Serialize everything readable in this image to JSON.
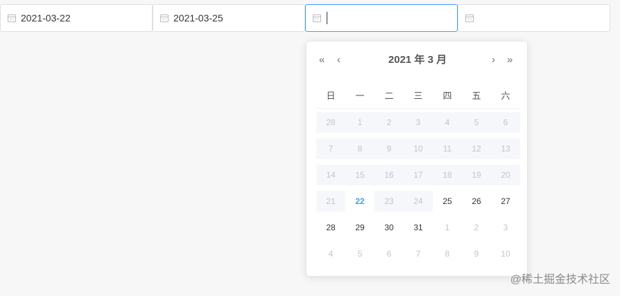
{
  "fields": [
    {
      "value": "2021-03-22",
      "icon": "calendar-icon"
    },
    {
      "value": "2021-03-25",
      "icon": "calendar-icon"
    },
    {
      "value": "",
      "icon": "calendar-icon"
    },
    {
      "value": "",
      "icon": "calendar-icon"
    }
  ],
  "calendar": {
    "prev_year": "«",
    "prev_month": "‹",
    "next_month": "›",
    "next_year": "»",
    "title": "2021 年  3 月",
    "weekdays": [
      "日",
      "一",
      "二",
      "三",
      "四",
      "五",
      "六"
    ],
    "weeks": [
      [
        {
          "d": "28",
          "s": "disabled"
        },
        {
          "d": "1",
          "s": "disabled"
        },
        {
          "d": "2",
          "s": "disabled"
        },
        {
          "d": "3",
          "s": "disabled"
        },
        {
          "d": "4",
          "s": "disabled"
        },
        {
          "d": "5",
          "s": "disabled"
        },
        {
          "d": "6",
          "s": "disabled"
        }
      ],
      [
        {
          "d": "7",
          "s": "disabled"
        },
        {
          "d": "8",
          "s": "disabled"
        },
        {
          "d": "9",
          "s": "disabled"
        },
        {
          "d": "10",
          "s": "disabled"
        },
        {
          "d": "11",
          "s": "disabled"
        },
        {
          "d": "12",
          "s": "disabled"
        },
        {
          "d": "13",
          "s": "disabled"
        }
      ],
      [
        {
          "d": "14",
          "s": "disabled"
        },
        {
          "d": "15",
          "s": "disabled"
        },
        {
          "d": "16",
          "s": "disabled"
        },
        {
          "d": "17",
          "s": "disabled"
        },
        {
          "d": "18",
          "s": "disabled"
        },
        {
          "d": "19",
          "s": "disabled"
        },
        {
          "d": "20",
          "s": "disabled"
        }
      ],
      [
        {
          "d": "21",
          "s": "disabled"
        },
        {
          "d": "22",
          "s": "today"
        },
        {
          "d": "23",
          "s": "disabled"
        },
        {
          "d": "24",
          "s": "disabled"
        },
        {
          "d": "25",
          "s": "available"
        },
        {
          "d": "26",
          "s": "available"
        },
        {
          "d": "27",
          "s": "available"
        }
      ],
      [
        {
          "d": "28",
          "s": "available"
        },
        {
          "d": "29",
          "s": "available"
        },
        {
          "d": "30",
          "s": "available"
        },
        {
          "d": "31",
          "s": "available"
        },
        {
          "d": "1",
          "s": "other"
        },
        {
          "d": "2",
          "s": "other"
        },
        {
          "d": "3",
          "s": "other"
        }
      ],
      [
        {
          "d": "4",
          "s": "other"
        },
        {
          "d": "5",
          "s": "other"
        },
        {
          "d": "6",
          "s": "other"
        },
        {
          "d": "7",
          "s": "other"
        },
        {
          "d": "8",
          "s": "other"
        },
        {
          "d": "9",
          "s": "other"
        },
        {
          "d": "10",
          "s": "other"
        }
      ]
    ]
  },
  "watermark": "@稀土掘金技术社区",
  "colors": {
    "accent": "#409eff",
    "disabled_bg": "#f5f7fa",
    "disabled_text": "#c0c4cc"
  }
}
